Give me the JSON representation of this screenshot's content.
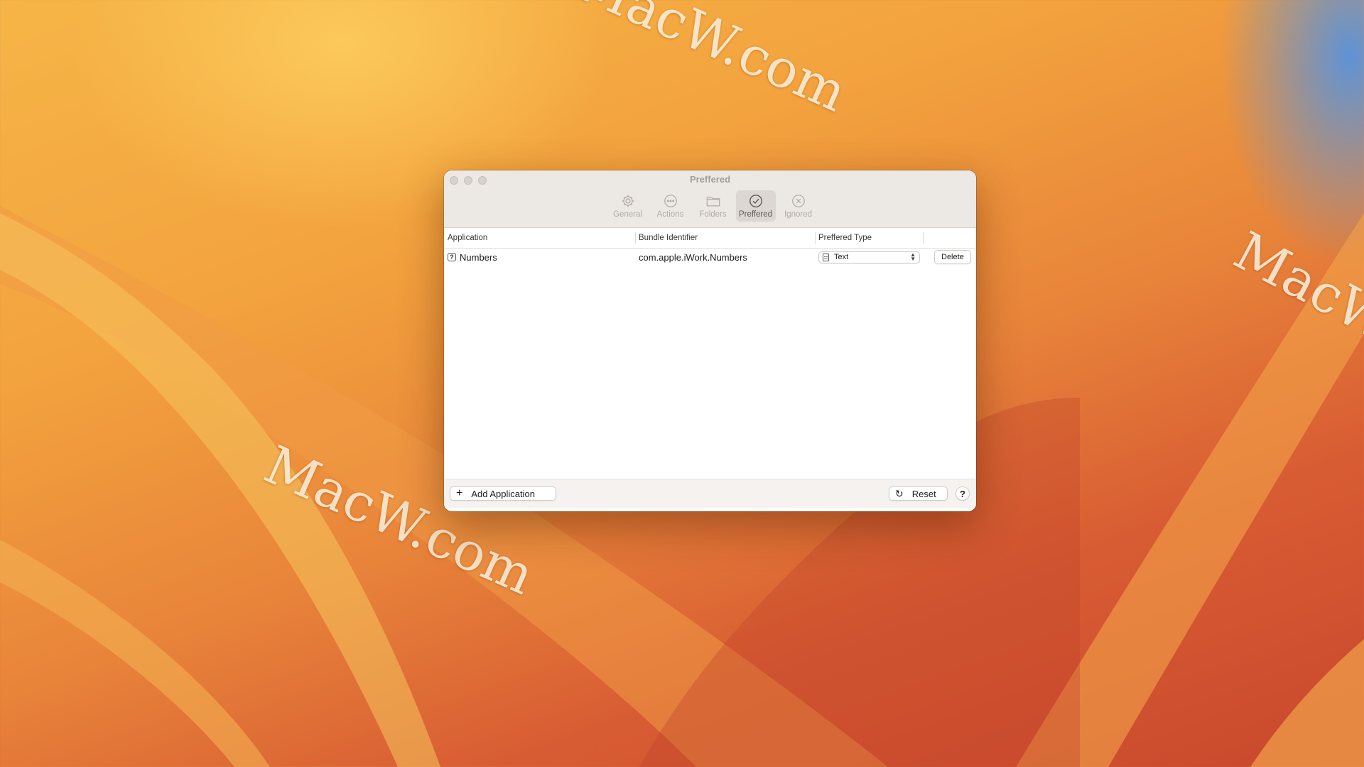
{
  "wallpaper": {
    "watermarks": [
      "MacW.com",
      "MacW.com",
      "MacW.com"
    ]
  },
  "window": {
    "title": "Preffered",
    "toolbar": [
      {
        "label": "General",
        "icon": "gear-icon",
        "active": false
      },
      {
        "label": "Actions",
        "icon": "ellipsis-circle-icon",
        "active": false
      },
      {
        "label": "Folders",
        "icon": "folder-icon",
        "active": false
      },
      {
        "label": "Preffered",
        "icon": "checkmark-circle-icon",
        "active": true
      },
      {
        "label": "Ignored",
        "icon": "x-circle-icon",
        "active": false
      }
    ],
    "table": {
      "headers": [
        "Application",
        "Bundle Identifier",
        "Preffered Type",
        ""
      ],
      "rows": [
        {
          "application": "Numbers",
          "app_icon_glyph": "?",
          "bundle_identifier": "com.apple.iWork.Numbers",
          "preferred_type": "Text",
          "delete_label": "Delete"
        }
      ]
    },
    "footer": {
      "add_label": "Add Application",
      "add_glyph": "+",
      "reset_label": "Reset",
      "reset_glyph": "↻",
      "help_label": "?"
    }
  }
}
